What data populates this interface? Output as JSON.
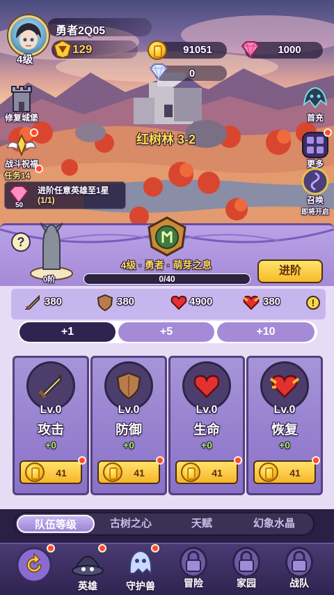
{
  "player": {
    "name": "勇者2Q05",
    "level_label": "4级",
    "power": "129"
  },
  "resources": {
    "gold": "91051",
    "gems": "1000",
    "crystal": "0"
  },
  "left_buttons": {
    "repair_castle": "修复城堡",
    "battle_blessing": "战斗祝福"
  },
  "right_buttons": {
    "first_recharge": "首充",
    "more": "更多",
    "summon": "召唤",
    "summon_sub": "即将开启"
  },
  "quest": {
    "tag": "任务14",
    "text": "进阶任意英雄至1星",
    "progress": "(1/1)",
    "reward_count": "50"
  },
  "stage": {
    "label": "红树林 3-2"
  },
  "hero_panel": {
    "stage_step": "0阶",
    "title": "4级 · 勇者 · 萌芽之息",
    "xp_text": "0/40",
    "xp_fraction": 0,
    "advance_label": "进阶",
    "help": "?"
  },
  "stats": {
    "attack": "380",
    "defense": "380",
    "hp": "4900",
    "recovery": "380"
  },
  "multipliers": [
    "+1",
    "+5",
    "+10"
  ],
  "cards": [
    {
      "lv": "Lv.0",
      "name": "攻击",
      "plus": "+0",
      "cost": "41",
      "icon": "sword-icon"
    },
    {
      "lv": "Lv.0",
      "name": "防御",
      "plus": "+0",
      "cost": "41",
      "icon": "shield-icon"
    },
    {
      "lv": "Lv.0",
      "name": "生命",
      "plus": "+0",
      "cost": "41",
      "icon": "heart-icon"
    },
    {
      "lv": "Lv.0",
      "name": "恢复",
      "plus": "+0",
      "cost": "41",
      "icon": "heal-icon"
    }
  ],
  "subtabs": [
    "队伍等级",
    "古树之心",
    "天赋",
    "幻象水晶"
  ],
  "nav": [
    "英雄",
    "守护兽",
    "冒险",
    "家园",
    "战队"
  ],
  "colors": {
    "accent_gold": "#ffd04a",
    "panel_purple": "#8a71c8",
    "active_tab": "#2f2450"
  }
}
